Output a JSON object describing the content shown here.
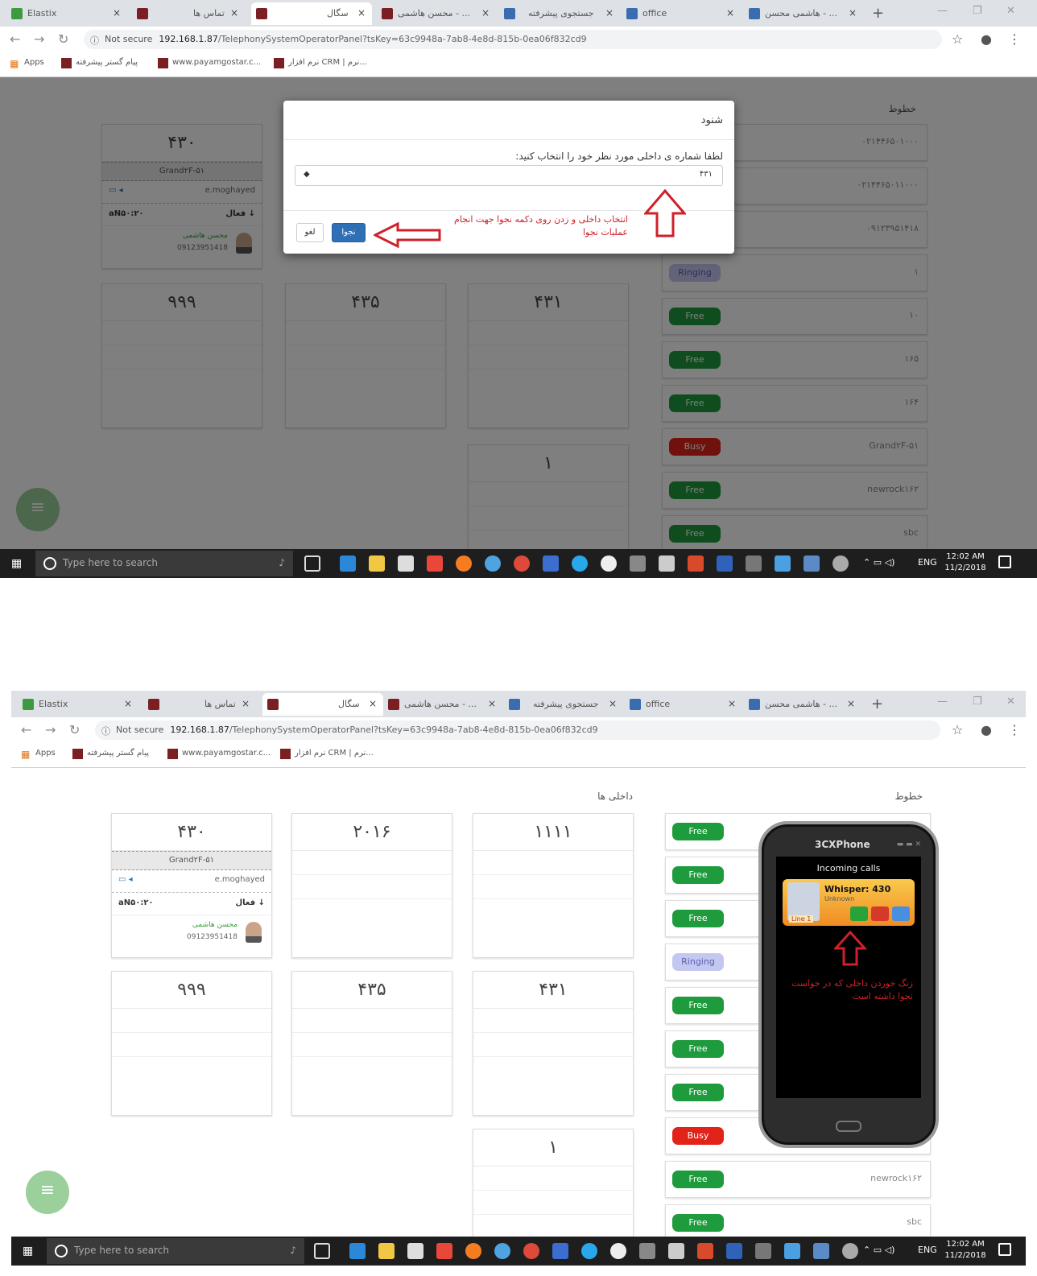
{
  "browser": {
    "tabs": [
      "Elastix",
      "",
      "تماس ها",
      "",
      "سگال",
      "",
      "محسن هاشمی - ...",
      "",
      "جستجوی پیشرفته",
      "office",
      "",
      "هاشمی محسن - ..."
    ],
    "tab_close": "×",
    "new_tab": "+",
    "window_controls": [
      "—",
      "❐",
      "✕"
    ],
    "not_secure": "Not secure",
    "url_host": "192.168.1.87",
    "url_path": "/TelephonySystemOperatorPanel?tsKey=63c9948a-7ab8-4e8d-815b-0ea06f832cd9",
    "bookmarks": [
      "Apps",
      "پیام گستر پیشرفته",
      "www.payamgostar.c...",
      "نرم افزار CRM | نرم..."
    ]
  },
  "panel": {
    "lines_title": "خطوط",
    "extensions_title": "داخلی ها"
  },
  "screen1": {
    "cards": [
      {
        "number": "۴۳۰",
        "trunk": "Grand۲F-۵۱",
        "agent": "e.moghayed",
        "left": "aN۵۰:۲۰",
        "right": "فعال ↓",
        "caller": "محسن هاشمی",
        "phone": "09123951418"
      },
      {
        "number": "۹۹۹"
      },
      {
        "number": "۴۳۵"
      },
      {
        "number": "۴۳۱"
      },
      {
        "number": "۱"
      }
    ],
    "lines": [
      {
        "status": "",
        "name": "۰۲۱۴۴۶۵۰۱۰۰۰"
      },
      {
        "status": "",
        "name": "۰۲۱۴۴۶۵۰۱۱۰۰۰"
      },
      {
        "status": "",
        "name": "۰۹۱۲۳۹۵۱۴۱۸"
      },
      {
        "status": "Ringing",
        "name": "۱"
      },
      {
        "status": "Free",
        "name": "۱۰"
      },
      {
        "status": "Free",
        "name": "۱۶۵"
      },
      {
        "status": "Free",
        "name": "۱۶۴"
      },
      {
        "status": "Busy",
        "name": "Grand۲F-۵۱"
      },
      {
        "status": "Free",
        "name": "newrock۱۶۲"
      },
      {
        "status": "Free",
        "name": "sbc"
      }
    ],
    "modal": {
      "title": "شنود",
      "label": "لطفا شماره ی داخلی مورد نظر خود را انتخاب کنید:",
      "selected": "۴۳۱",
      "caret": "◆",
      "ok": "نجوا",
      "cancel": "لغو",
      "note": "انتخاب داخلی و زدن روی دکمه نجوا جهت انجام عملیات نجوا"
    }
  },
  "screen2": {
    "cards": [
      {
        "number": "۴۳۰",
        "trunk": "Grand۲F-۵۱",
        "agent": "e.moghayed",
        "left": "aN۵۰:۲۰",
        "right": "فعال ↓",
        "caller": "محسن هاشمی",
        "phone": "09123951418"
      },
      {
        "number": "۲۰۱۶"
      },
      {
        "number": "۱۱۱۱"
      },
      {
        "number": "۹۹۹"
      },
      {
        "number": "۴۳۵"
      },
      {
        "number": "۴۳۱"
      },
      {
        "number": "۱"
      }
    ],
    "lines": [
      {
        "status": "Free",
        "name": ""
      },
      {
        "status": "Free",
        "name": ""
      },
      {
        "status": "Free",
        "name": ""
      },
      {
        "status": "Ringing",
        "name": ""
      },
      {
        "status": "Free",
        "name": ""
      },
      {
        "status": "Free",
        "name": ""
      },
      {
        "status": "Free",
        "name": ""
      },
      {
        "status": "Busy",
        "name": ""
      },
      {
        "status": "Free",
        "name": "newrock۱۶۲"
      },
      {
        "status": "Free",
        "name": "sbc"
      }
    ],
    "phone": {
      "title": "3CXPhone",
      "incoming": "Incoming calls",
      "whisper": "Whisper: 430",
      "unknown": "Unknown",
      "line": "Line 1",
      "note": "زنگ خوردن داخلی که در خواست نجوا داشته است"
    }
  },
  "taskbar": {
    "search_placeholder": "Type here to search",
    "lang": "ENG",
    "time": "12:02 AM",
    "date": "11/2/2018"
  },
  "colors": {
    "free": "#1e9b3c",
    "busy": "#e2231a",
    "ringing": "#c4c7f0",
    "primary": "#2f6fb5",
    "annotation": "#d0202a"
  }
}
